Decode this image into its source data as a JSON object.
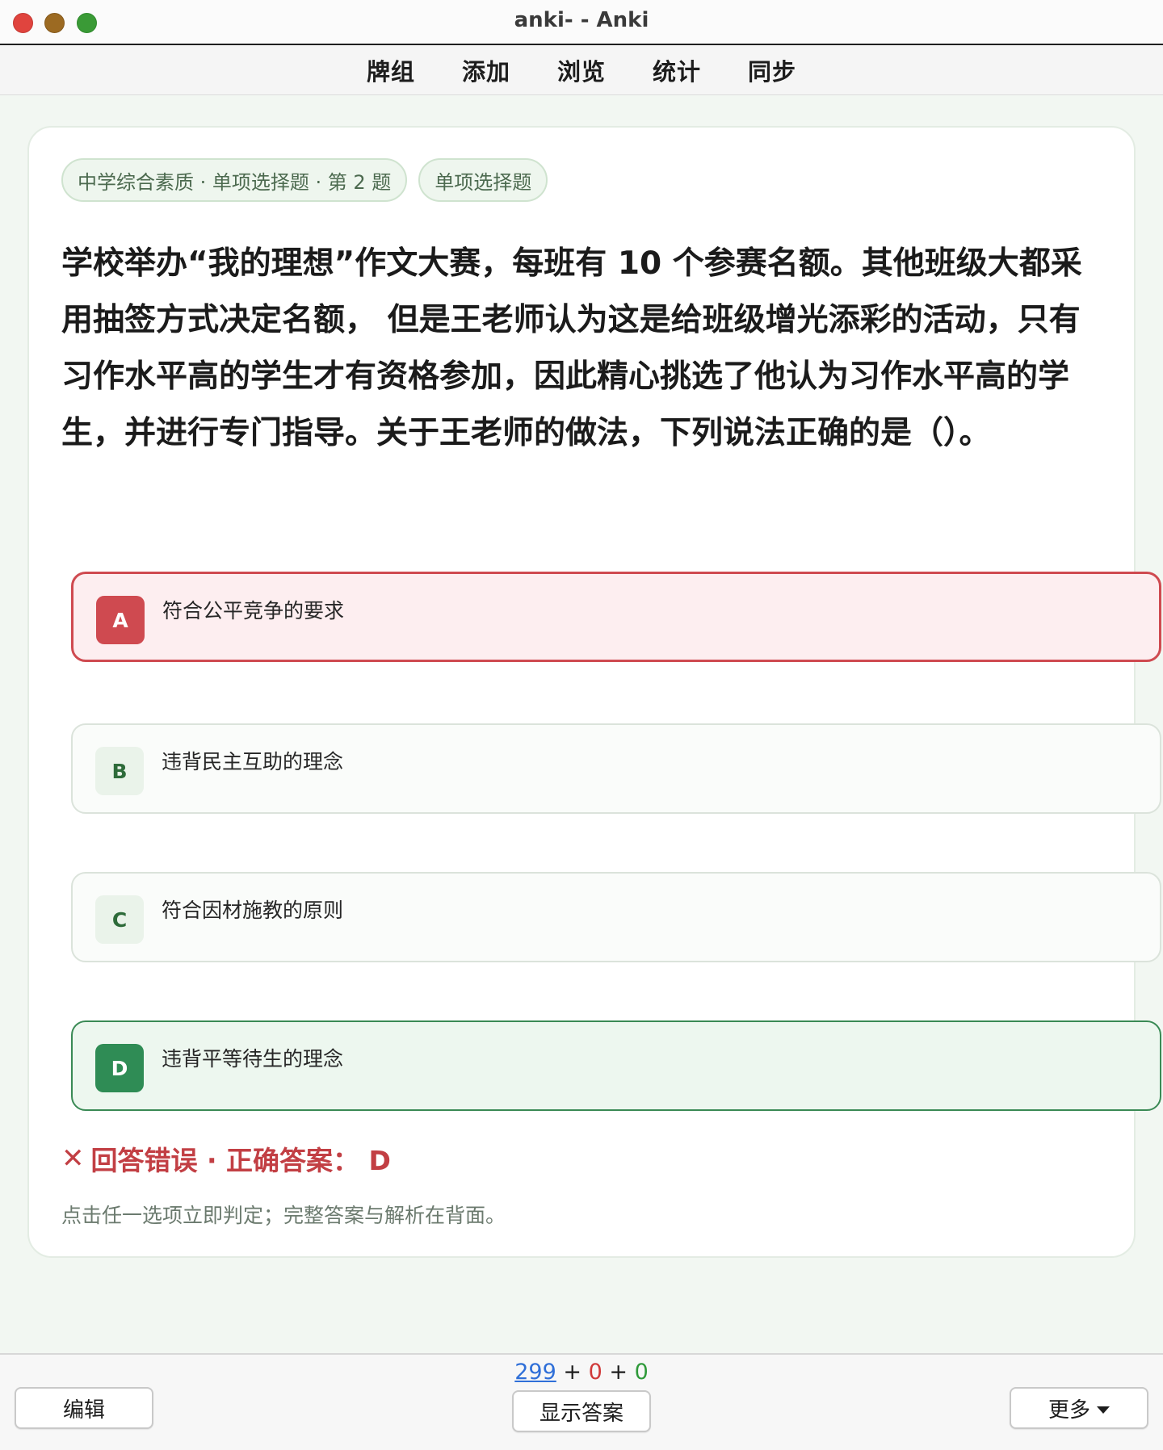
{
  "window": {
    "title": "anki- - Anki"
  },
  "nav": {
    "items": [
      "牌组",
      "添加",
      "浏览",
      "统计",
      "同步"
    ]
  },
  "card": {
    "tags": [
      "中学综合素质 · 单项选择题 · 第 2 题",
      "单项选择题"
    ],
    "question": "学校举办“我的理想”作文大赛，每班有 10 个参赛名额。其他班级大都采用抽签方式决定名额， 但是王老师认为这是给班级增光添彩的活动，只有习作水平高的学生才有资格参加，因此精心挑选了他认为习作水平高的学生，并进行专门指导。关于王老师的做法，下列说法正确的是（）。",
    "options": [
      {
        "letter": "A",
        "text": "符合公平竞争的要求",
        "state": "selected-wrong",
        "color": "#cf4a50"
      },
      {
        "letter": "B",
        "text": "违背民主互助的理念",
        "state": "neutral"
      },
      {
        "letter": "C",
        "text": "符合因材施教的原则",
        "state": "neutral"
      },
      {
        "letter": "D",
        "text": "违背平等待生的理念",
        "state": "correct",
        "color": "#2f8c55"
      }
    ],
    "result": {
      "icon": "✕",
      "text": "回答错误 · 正确答案： D",
      "color": "#c23f44"
    },
    "hint": "点击任一选项立即判定；完整答案与解析在背面。"
  },
  "bottom": {
    "edit_label": "编辑",
    "show_answer_label": "显示答案",
    "more_label": "更多",
    "counts": {
      "new": "299",
      "sep1": " + ",
      "learn": "0",
      "sep2": " + ",
      "review": "0"
    }
  }
}
